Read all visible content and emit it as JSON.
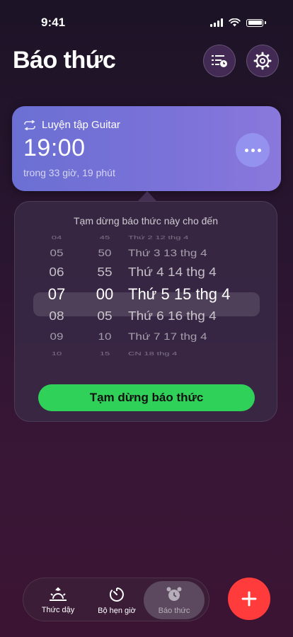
{
  "status_bar": {
    "time": "9:41"
  },
  "header": {
    "title": "Báo thức",
    "sort_icon": "list-clock-icon",
    "settings_icon": "gear-icon"
  },
  "alarm": {
    "label": "Luyện tập Guitar",
    "repeat_icon": "repeat-icon",
    "time": "19:00",
    "subtitle": "trong 33 giờ, 19 phút"
  },
  "snooze_popover": {
    "title": "Tạm dừng báo thức này cho đến",
    "rows": [
      {
        "hour": "04",
        "minute": "45",
        "day": "Thứ 2 12 thg 4"
      },
      {
        "hour": "05",
        "minute": "50",
        "day": "Thứ 3 13 thg 4"
      },
      {
        "hour": "06",
        "minute": "55",
        "day": "Thứ 4 14 thg 4"
      },
      {
        "hour": "07",
        "minute": "00",
        "day": "Thứ 5 15 thg 4"
      },
      {
        "hour": "08",
        "minute": "05",
        "day": "Thứ 6 16 thg 4"
      },
      {
        "hour": "09",
        "minute": "10",
        "day": "Thứ 7 17 thg 4"
      },
      {
        "hour": "10",
        "minute": "15",
        "day": "CN 18 thg 4"
      }
    ],
    "selected_index": 3,
    "button_label": "Tạm dừng báo thức"
  },
  "tabs": [
    {
      "label": "Thức dậy",
      "icon": "sunrise-icon",
      "active": false
    },
    {
      "label": "Bộ hẹn giờ",
      "icon": "timer-icon",
      "active": false
    },
    {
      "label": "Báo thức",
      "icon": "alarm-clock-icon",
      "active": true
    }
  ],
  "fab": {
    "icon": "plus-icon"
  },
  "colors": {
    "accent_green": "#30d158",
    "fab_red": "#ff3b3b",
    "card_purple": "#7b72d8"
  }
}
